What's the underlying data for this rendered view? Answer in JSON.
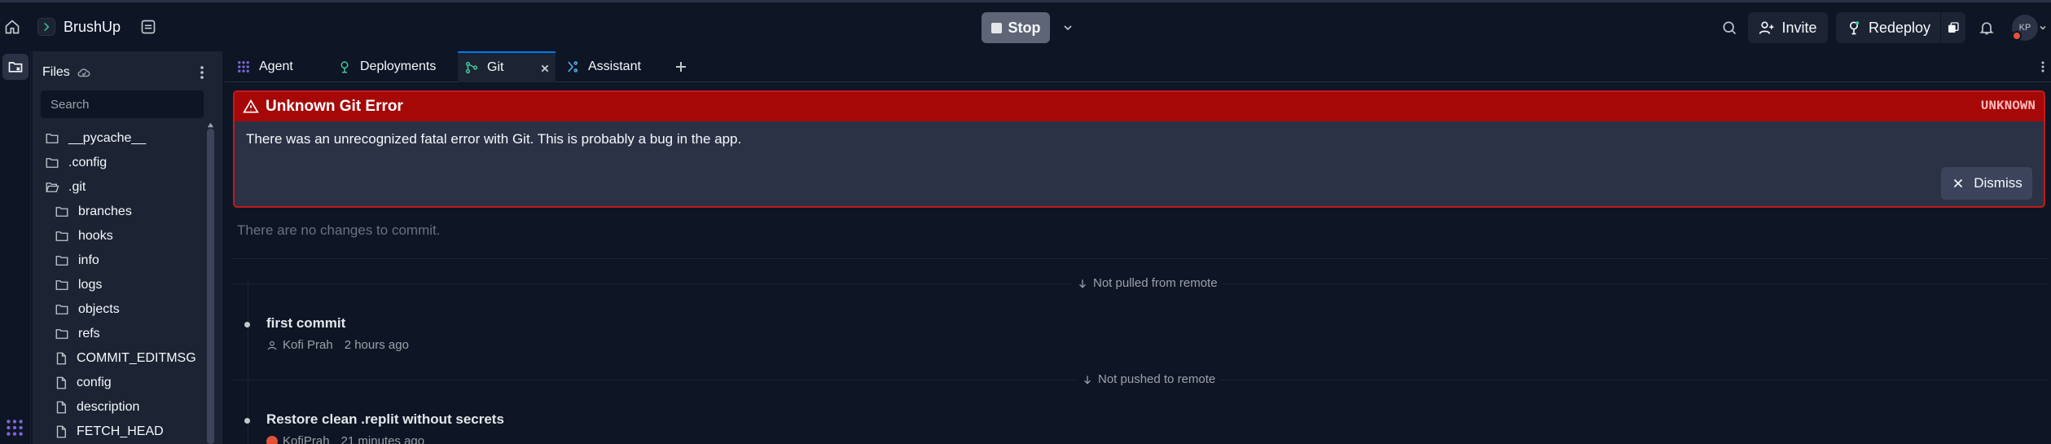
{
  "app": {
    "repl_title": "BrushUp",
    "stop_label": "Stop",
    "invite_label": "Invite",
    "redeploy_label": "Redeploy",
    "avatar_initials": "KP"
  },
  "files": {
    "title": "Files",
    "search_placeholder": "Search",
    "items": [
      {
        "label": "__pycache__",
        "type": "folder"
      },
      {
        "label": ".config",
        "type": "folder"
      },
      {
        "label": ".git",
        "type": "folder-open"
      },
      {
        "label": "branches",
        "type": "folder"
      },
      {
        "label": "hooks",
        "type": "folder"
      },
      {
        "label": "info",
        "type": "folder"
      },
      {
        "label": "logs",
        "type": "folder"
      },
      {
        "label": "objects",
        "type": "folder"
      },
      {
        "label": "refs",
        "type": "folder"
      },
      {
        "label": "COMMIT_EDITMSG",
        "type": "file"
      },
      {
        "label": "config",
        "type": "file"
      },
      {
        "label": "description",
        "type": "file"
      },
      {
        "label": "FETCH_HEAD",
        "type": "file"
      }
    ]
  },
  "tabs": [
    {
      "label": "Agent",
      "icon": "agent-icon"
    },
    {
      "label": "Deployments",
      "icon": "deployments-icon"
    },
    {
      "label": "Git",
      "icon": "git-icon",
      "active": true
    },
    {
      "label": "Assistant",
      "icon": "assistant-icon"
    }
  ],
  "error": {
    "title": "Unknown Git Error",
    "code": "UNKNOWN",
    "message": "There was an unrecognized fatal error with Git. This is probably a bug in the app.",
    "dismiss_label": "Dismiss"
  },
  "git": {
    "no_changes": "There are no changes to commit.",
    "not_pulled_label": "Not pulled from remote",
    "not_pushed_label": "Not pushed to remote",
    "commits": [
      {
        "title": "first commit",
        "author": "Kofi Prah",
        "time": "2 hours ago"
      },
      {
        "title": "Restore clean .replit without secrets",
        "author": "KofiPrah",
        "time": "21 minutes ago"
      }
    ]
  },
  "colors": {
    "background": "#0e1525",
    "panel": "#1c2333",
    "error_header": "#a60808",
    "error_border": "#c21a1a",
    "active_tab_accent": "#0079f2"
  }
}
